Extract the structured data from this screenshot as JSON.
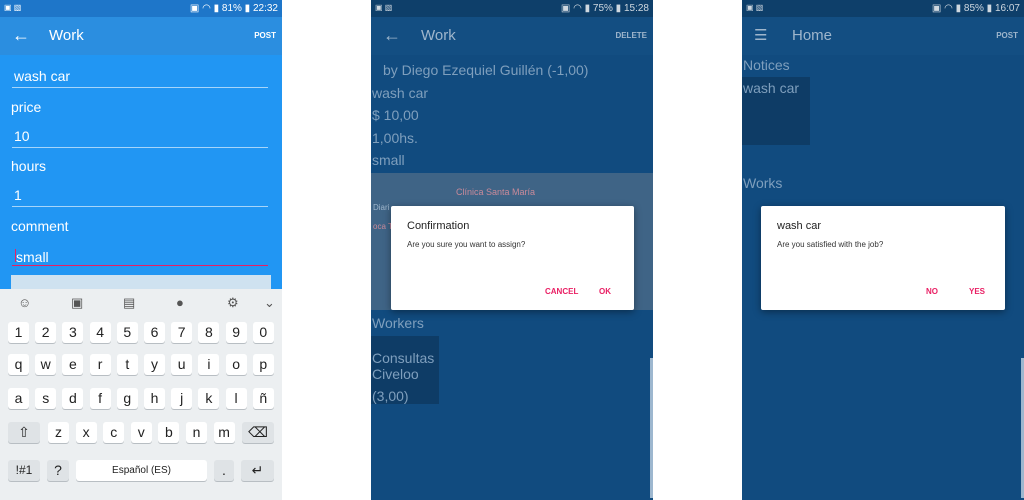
{
  "screen1": {
    "status": {
      "left": "▣ ▧",
      "right": "▣ ◠ ▮ 81% ▮ 22:32"
    },
    "appbar": {
      "back": "←",
      "title": "Work",
      "action": "POST"
    },
    "fields": {
      "title_value": "wash car",
      "price_label": "price",
      "price_value": "10",
      "hours_label": "hours",
      "hours_value": "1",
      "comment_label": "comment",
      "comment_value": "small"
    },
    "keyboard": {
      "toolbar": [
        "☺",
        "▣",
        "▤",
        "●",
        "⚙",
        "⌄"
      ],
      "row_numbers": [
        "1",
        "2",
        "3",
        "4",
        "5",
        "6",
        "7",
        "8",
        "9",
        "0"
      ],
      "row_1": [
        "q",
        "w",
        "e",
        "r",
        "t",
        "y",
        "u",
        "i",
        "o",
        "p"
      ],
      "row_2": [
        "a",
        "s",
        "d",
        "f",
        "g",
        "h",
        "j",
        "k",
        "l",
        "ñ"
      ],
      "row_3": [
        "z",
        "x",
        "c",
        "v",
        "b",
        "n",
        "m"
      ],
      "shift": "⇧",
      "backspace": "⌫",
      "symbols": "!#1",
      "question": "?",
      "space": "Español (ES)",
      "period": ".",
      "enter": "↵"
    }
  },
  "screen2": {
    "status": {
      "left": "▣ ▧",
      "right": "▣ ◠ ▮ 75% ▮ 15:28"
    },
    "appbar": {
      "back": "←",
      "title": "Work",
      "action": "DELETE"
    },
    "details": {
      "by_line": "by  Diego Ezequiel Guillén (-1,00)",
      "title": "wash car",
      "price": "$ 10,00",
      "hours": "1,00hs.",
      "comment": "small"
    },
    "map": {
      "place": "Clínica Santa María",
      "left1": "Diari",
      "left2": "oca T"
    },
    "workers_label": "Workers",
    "worker": {
      "name_1": "Consultas",
      "name_2": "Civeloo",
      "rating": "(3,00)"
    },
    "dialog": {
      "title": "Confirmation",
      "message": "Are you sure you want to assign?",
      "cancel": "CANCEL",
      "ok": "OK"
    }
  },
  "screen3": {
    "status": {
      "left": "▣ ▧",
      "right": "▣ ◠ ▮ 85% ▮ 16:07"
    },
    "appbar": {
      "menu": "☰",
      "title": "Home",
      "action": "POST"
    },
    "notices_label": "Notices",
    "notice_item": "wash car",
    "works_label": "Works",
    "dialog": {
      "title": "wash car",
      "message": "Are you satisfied with the job?",
      "no": "NO",
      "yes": "YES"
    }
  },
  "colors": {
    "appbar": "#2b8ee0",
    "form_bg": "#2196f3",
    "dim_bg": "#114b7f",
    "accent": "#e91e63",
    "keyboard_bg": "#eceff1"
  }
}
